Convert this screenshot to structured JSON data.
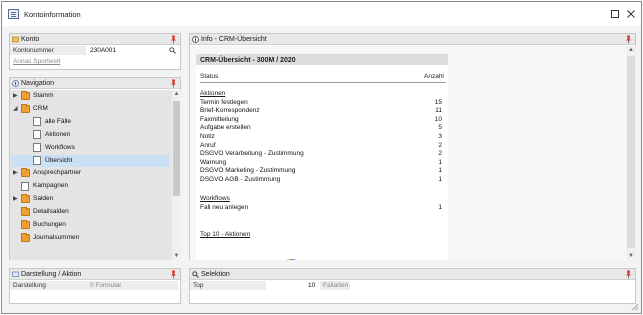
{
  "window": {
    "title": "Kontoinformation"
  },
  "konto": {
    "header": "Konto",
    "label": "Kontonummer",
    "value": "230A001",
    "link": "Annas Sportwelt"
  },
  "navigation": {
    "header": "Navigation",
    "items": [
      {
        "label": "Stamm",
        "type": "folder",
        "level": 0,
        "toggle": "▶",
        "selected": false
      },
      {
        "label": "CRM",
        "type": "folder",
        "level": 0,
        "toggle": "◢",
        "selected": false
      },
      {
        "label": "alle Fälle",
        "type": "doc",
        "level": 1,
        "toggle": "",
        "selected": false
      },
      {
        "label": "Aktionen",
        "type": "doc",
        "level": 1,
        "toggle": "",
        "selected": false
      },
      {
        "label": "Workflows",
        "type": "doc",
        "level": 1,
        "toggle": "",
        "selected": false
      },
      {
        "label": "Übersicht",
        "type": "doc",
        "level": 1,
        "toggle": "",
        "selected": true
      },
      {
        "label": "Ansprechpartner",
        "type": "folder",
        "level": 0,
        "toggle": "▶",
        "selected": false
      },
      {
        "label": "Kampagnen",
        "type": "doc",
        "level": 0,
        "toggle": "",
        "selected": false
      },
      {
        "label": "Salden",
        "type": "folder",
        "level": 0,
        "toggle": "▶",
        "selected": false
      },
      {
        "label": "Detailsalden",
        "type": "folder",
        "level": 0,
        "toggle": "",
        "selected": false
      },
      {
        "label": "Buchungen",
        "type": "folder",
        "level": 0,
        "toggle": "",
        "selected": false
      },
      {
        "label": "Journalsummen",
        "type": "folder",
        "level": 0,
        "toggle": "",
        "selected": false
      }
    ]
  },
  "darstellung": {
    "header": "Darstellung / Aktion",
    "label": "Darstellung",
    "value": "0 Formular"
  },
  "info": {
    "header": "Info - CRM-Übersicht",
    "report": {
      "title": "CRM-Übersicht - 300M / 2020",
      "col_status": "Status",
      "col_count": "Anzahl",
      "section_aktionen": "Aktionen",
      "aktionen": [
        {
          "label": "Termin festlegen",
          "count": "15"
        },
        {
          "label": "Brief-Korrespondenz",
          "count": "11"
        },
        {
          "label": "Faxmitteilung",
          "count": "10"
        },
        {
          "label": "Aufgabe erstellen",
          "count": "5"
        },
        {
          "label": "Notiz",
          "count": "3"
        },
        {
          "label": "Anruf",
          "count": "2"
        },
        {
          "label": "DSGVO Verarbeitung - Zustimmung",
          "count": "2"
        },
        {
          "label": "Warnung",
          "count": "1"
        },
        {
          "label": "DSGVO Marketing - Zustimmung",
          "count": "1"
        },
        {
          "label": "DSGVO AGB - Zustimmung",
          "count": "1"
        }
      ],
      "section_workflows": "Workflows",
      "workflows": [
        {
          "label": "Fall neu anlegen",
          "count": "1"
        }
      ],
      "section_top10": "Top 10 - Aktionen"
    }
  },
  "selektion": {
    "header": "Selektion",
    "top_label": "Top",
    "top_value": "10",
    "fallarten_label": "Fallarten"
  },
  "colors": {
    "selected_row": "#cce0f5",
    "folder": "#f0a030",
    "pin_red": "#d9342b",
    "pie_blue": "#2f7fc1"
  }
}
